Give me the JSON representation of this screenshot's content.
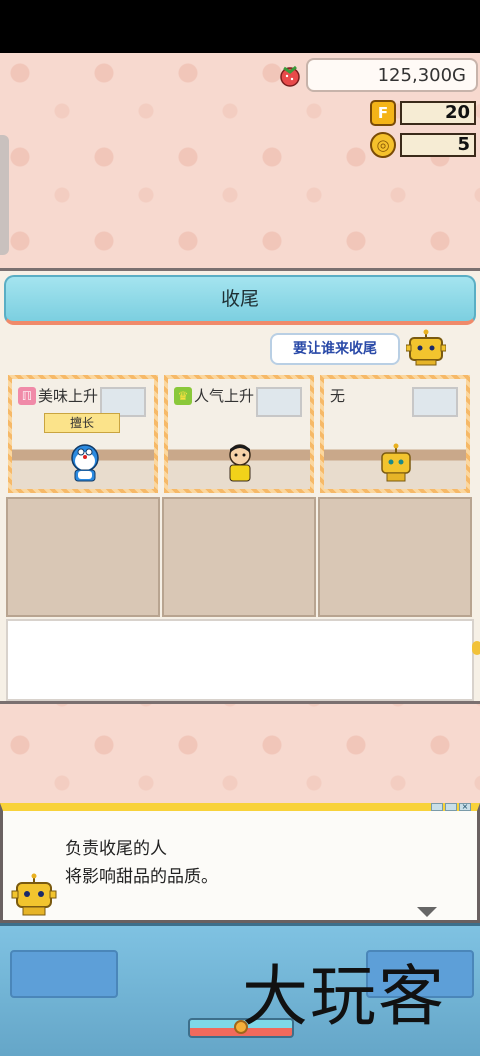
{
  "currency": {
    "money": "125,300G",
    "f_points": "20",
    "coins": "5",
    "f_icon_label": "F",
    "coin_icon_label": "◎"
  },
  "panel": {
    "title": "收尾",
    "question": "要让谁来收尾"
  },
  "slots": [
    {
      "label": "美味上升",
      "badge": "擅长",
      "icon": "fork-knife-icon",
      "character": "blue-robot-cat"
    },
    {
      "label": "人气上升",
      "icon": "crown-icon",
      "character": "boy-yellow-shirt"
    },
    {
      "label": "无",
      "icon": "",
      "character": "yellow-robot"
    }
  ],
  "dialog": {
    "line1": "负责收尾的人",
    "line2": "将影响甜品的品质。"
  },
  "watermark": "大玩客",
  "colors": {
    "header": "#7ccfe0",
    "accent": "#f08a6a",
    "slot_border": "#f6b968",
    "dialog_top": "#f8d23a"
  }
}
